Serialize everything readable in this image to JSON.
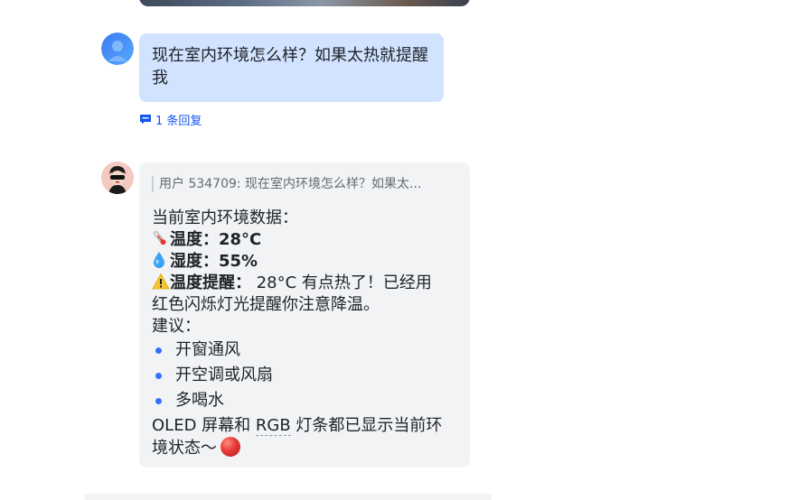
{
  "messages": {
    "user": {
      "text": "现在室内环境怎么样？如果太热就提醒我",
      "reply_count": "1 条回复"
    },
    "bot": {
      "quote": "用户 534709: 现在室内环境怎么样？如果太...",
      "heading": "当前室内环境数据：",
      "temperature_label": "温度：",
      "temperature_value": "28°C",
      "humidity_label": "湿度：",
      "humidity_value": "55%",
      "alert_label": "温度提醒：",
      "alert_text_1": " 28°C 有点热了！已经用",
      "alert_text_2": "红色闪烁灯光提醒你注意降温。",
      "suggestions_heading": "建议：",
      "suggestions": [
        "开窗通风",
        "开空调或风扇",
        "多喝水"
      ],
      "footer_prefix": "OLED 屏幕和 ",
      "footer_rgb": "RGB",
      "footer_mid": " 灯条都已显示当前环",
      "footer_line2": "境状态～"
    }
  },
  "icons": {
    "thermometer": "thermometer-icon",
    "droplet": "droplet-icon",
    "warning": "warning-icon",
    "reply": "comment-icon",
    "red_circle": "red-circle-emoji"
  },
  "colors": {
    "accent": "#1456f0",
    "user_bubble": "#d1e3fe",
    "bot_bubble": "#f2f3f5",
    "bullet": "#3370ff"
  }
}
